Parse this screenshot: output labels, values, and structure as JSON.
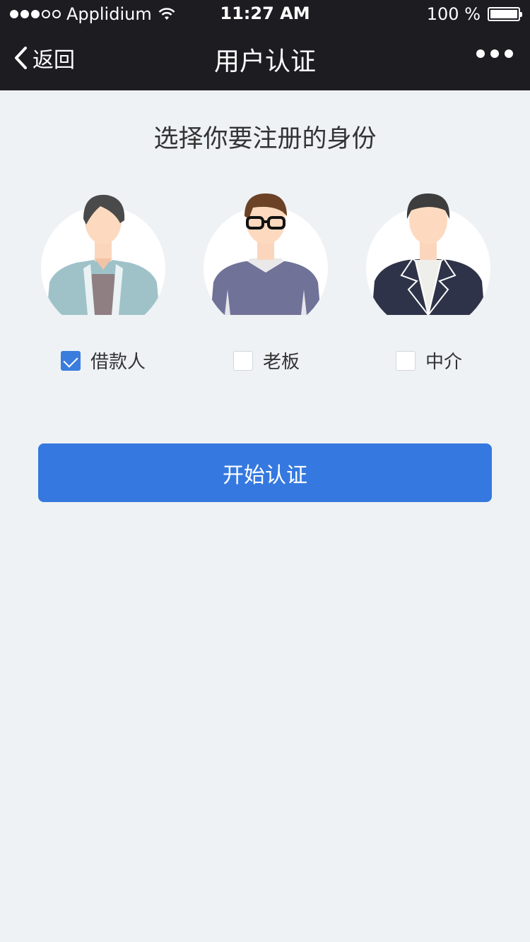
{
  "status_bar": {
    "carrier": "Applidium",
    "time": "11:27 AM",
    "battery": "100 %",
    "signal_bars_filled": 3,
    "signal_bars_total": 5
  },
  "nav": {
    "back_label": "返回",
    "title": "用户认证"
  },
  "heading": "选择你要注册的身份",
  "roles": [
    {
      "label": "借款人",
      "checked": true
    },
    {
      "label": "老板",
      "checked": false
    },
    {
      "label": "中介",
      "checked": false
    }
  ],
  "start_button": "开始认证",
  "colors": {
    "accent": "#3579e0",
    "nav_bg": "#1c1c21",
    "page_bg": "#eef2f5"
  }
}
